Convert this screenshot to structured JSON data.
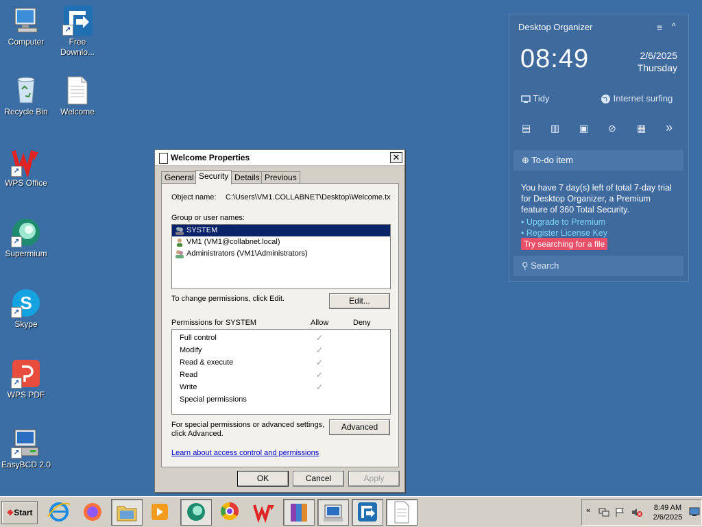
{
  "desktop": {
    "icons": [
      {
        "label": "Computer"
      },
      {
        "label": "Free Downlo..."
      },
      {
        "label": "Recycle Bin"
      },
      {
        "label": "Welcome"
      },
      {
        "label": "WPS Office"
      },
      {
        "label": "Supermium"
      },
      {
        "label": "Skype"
      },
      {
        "label": "WPS PDF"
      },
      {
        "label": "EasyBCD 2.0"
      }
    ]
  },
  "dialog": {
    "title": "Welcome Properties",
    "close_glyph": "✕",
    "tabs": [
      "General",
      "Security",
      "Details",
      "Previous Versions"
    ],
    "active_tab": "Security",
    "object_name_label": "Object name:",
    "object_name_value": "C:\\Users\\VM1.COLLABNET\\Desktop\\Welcome.tx",
    "group_label": "Group or user names:",
    "users": [
      "SYSTEM",
      "VM1 (VM1@collabnet.local)",
      "Administrators (VM1\\Administrators)"
    ],
    "change_text": "To change permissions, click Edit.",
    "edit_button": "Edit...",
    "permissions_for": "Permissions for SYSTEM",
    "allow_header": "Allow",
    "deny_header": "Deny",
    "permissions": [
      {
        "name": "Full control",
        "allow": "✓"
      },
      {
        "name": "Modify",
        "allow": "✓"
      },
      {
        "name": "Read & execute",
        "allow": "✓"
      },
      {
        "name": "Read",
        "allow": "✓"
      },
      {
        "name": "Write",
        "allow": "✓"
      },
      {
        "name": "Special permissions",
        "allow": ""
      }
    ],
    "special_text_1": "For special permissions or advanced settings,",
    "special_text_2": "click Advanced.",
    "advanced_button": "Advanced",
    "learn_link": "Learn about access control and permissions",
    "ok_button": "OK",
    "cancel_button": "Cancel",
    "apply_button": "Apply"
  },
  "organizer": {
    "title": "Desktop Organizer",
    "menu_glyph": "≡",
    "collapse_glyph": "^",
    "time": "08:49",
    "date": "2/6/2025",
    "weekday": "Thursday",
    "tidy": "Tidy",
    "internet": "Internet surfing",
    "more_glyph": "»",
    "todo": "To-do item",
    "todo_glyph": "⊕",
    "trial_text": "You have 7 day(s) left of total 7-day trial for Desktop Organizer, a Premium feature of 360 Total Security.",
    "upgrade_link": "• Upgrade to Premium",
    "register_link": "• Register License Key",
    "tooltip": "Try searching for a file",
    "search_placeholder": "Search",
    "search_glyph": "⚲"
  },
  "taskbar": {
    "start_label": "Start",
    "clock_time": "8:49 AM",
    "clock_date": "2/6/2025",
    "tray_expand_glyph": "«"
  },
  "colors": {
    "desktop": "#3a6ea5",
    "selection": "#0a246a",
    "widget": "#3e6a9e",
    "link": "#7dd3f0",
    "tooltip": "#e8506a"
  }
}
